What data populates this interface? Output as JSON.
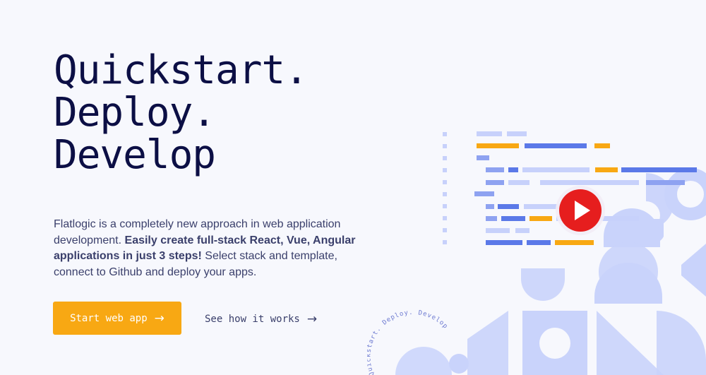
{
  "hero": {
    "line1": "Quickstart.",
    "line2": "Deploy.",
    "line3": "Develop",
    "desc_part1": "Flatlogic is a completely new approach in web application development.",
    "desc_bold": "Easily create full-stack React, Vue, Angular applications in just 3 steps!",
    "desc_part2": "Select stack and template, connect to Github and deploy your apps."
  },
  "actions": {
    "primary_label": "Start web app",
    "primary_arrow": "→",
    "secondary_label": "See how it works",
    "secondary_arrow": "→"
  },
  "illustration": {
    "circular_text": "Quickstart. Deploy. Develop",
    "play_icon": "play-icon",
    "colors": {
      "accent": "#f8a813",
      "code_blue": "#5b79e8",
      "code_light": "#c7d1fb",
      "shape": "#c9d3fb",
      "play": "#e61e1e"
    }
  }
}
